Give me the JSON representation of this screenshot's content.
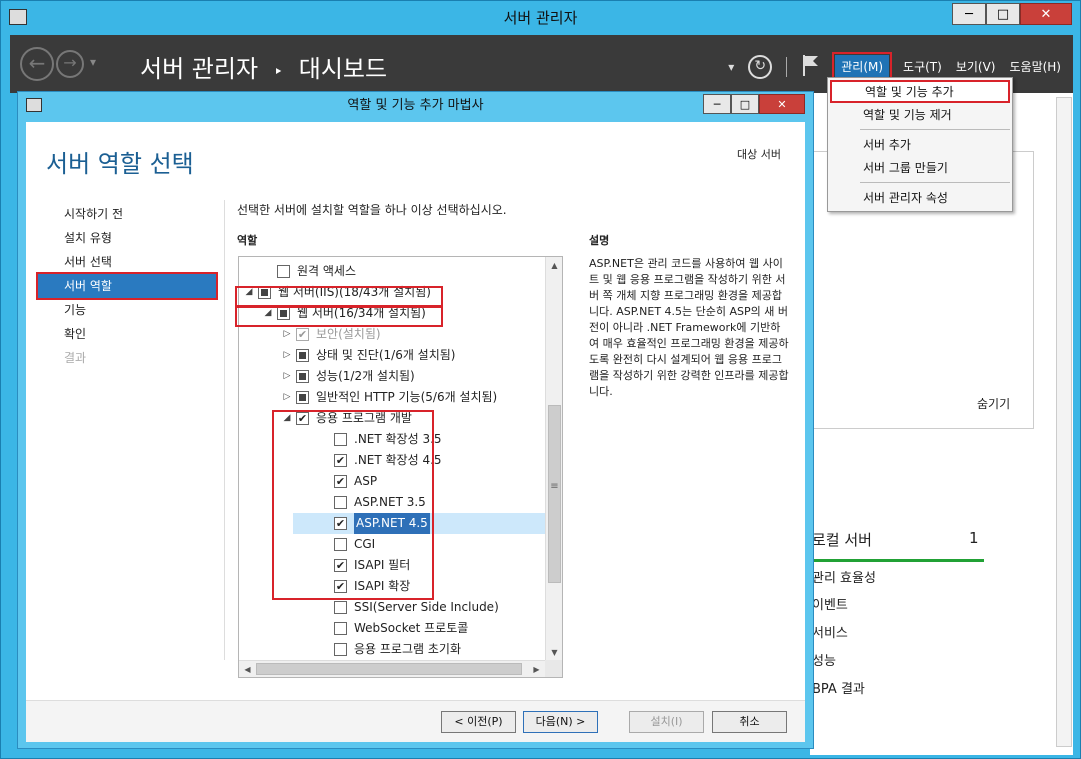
{
  "window": {
    "title": "서버 관리자",
    "minimize": "─",
    "maximize": "□",
    "close": "✕"
  },
  "appbar": {
    "back": "←",
    "forward": "→",
    "nav_dropdown": "▾",
    "title": "서버 관리자",
    "separator": "‣",
    "subtitle": "대시보드",
    "refresh_dropdown": "▾",
    "refresh": "↻",
    "menus": [
      "관리(M)",
      "도구(T)",
      "보기(V)",
      "도움말(H)"
    ]
  },
  "manage_menu": {
    "items": [
      "역할 및 기능 추가",
      "역할 및 기능 제거",
      "서버 추가",
      "서버 그룹 만들기",
      "서버 관리자 속성"
    ]
  },
  "background": {
    "hide": "숨기기",
    "local_server": "로컬 서버",
    "local_server_count": "1",
    "items": [
      "관리 효율성",
      "이벤트",
      "서비스",
      "성능",
      "BPA 결과"
    ]
  },
  "dialog": {
    "title": "역할 및 기능 추가 마법사",
    "minimize": "─",
    "maximize": "□",
    "close": "✕",
    "page_title": "서버 역할 선택",
    "destination": "대상 서버",
    "steps": [
      "시작하기 전",
      "설치 유형",
      "서버 선택",
      "서버 역할",
      "기능",
      "확인",
      "결과"
    ],
    "instruction": "선택한 서버에 설치할 역할을 하나 이상 선택하십시오.",
    "roles_label": "역할",
    "desc_label": "설명",
    "description": "ASP.NET은 관리 코드를 사용하여 웹 사이트 및 웹 응용 프로그램을 작성하기 위한 서버 쪽 개체 지향 프로그래밍 환경을 제공합니다. ASP.NET 4.5는 단순히 ASP의 새 버전이 아니라 .NET Framework에 기반하여 매우 효율적인 프로그래밍 환경을 제공하도록 완전히 다시 설계되어 웹 응용 프로그램을 작성하기 위한 강력한 인프라를 제공합니다.",
    "tree": [
      {
        "label": "원격 액세스",
        "state": "unchecked",
        "expander": ""
      },
      {
        "label": "웹 서버(IIS)(18/43개 설치됨)",
        "state": "partial",
        "expander": "◢"
      },
      {
        "label": "웹 서버(16/34개 설치됨)",
        "state": "partial",
        "expander": "◢"
      },
      {
        "label": "보안(설치됨)",
        "state": "checked-disabled",
        "expander": "▷"
      },
      {
        "label": "상태 및 진단(1/6개 설치됨)",
        "state": "partial",
        "expander": "▷"
      },
      {
        "label": "성능(1/2개 설치됨)",
        "state": "partial",
        "expander": "▷"
      },
      {
        "label": "일반적인 HTTP 기능(5/6개 설치됨)",
        "state": "partial",
        "expander": "▷"
      },
      {
        "label": "응용 프로그램 개발",
        "state": "checked",
        "expander": "◢"
      },
      {
        "label": ".NET 확장성 3.5",
        "state": "unchecked",
        "expander": ""
      },
      {
        "label": ".NET 확장성 4.5",
        "state": "checked",
        "expander": ""
      },
      {
        "label": "ASP",
        "state": "checked",
        "expander": ""
      },
      {
        "label": "ASP.NET 3.5",
        "state": "unchecked",
        "expander": ""
      },
      {
        "label": "ASP.NET 4.5",
        "state": "checked",
        "expander": ""
      },
      {
        "label": "CGI",
        "state": "unchecked",
        "expander": ""
      },
      {
        "label": "ISAPI 필터",
        "state": "checked",
        "expander": ""
      },
      {
        "label": "ISAPI 확장",
        "state": "checked",
        "expander": ""
      },
      {
        "label": "SSI(Server Side Include)",
        "state": "unchecked",
        "expander": ""
      },
      {
        "label": "WebSocket 프로토콜",
        "state": "unchecked",
        "expander": ""
      },
      {
        "label": "응용 프로그램 초기화",
        "state": "unchecked",
        "expander": ""
      }
    ],
    "scroll": {
      "up": "▲",
      "down": "▼",
      "left": "◀",
      "right": "▶",
      "grip": "≡"
    },
    "buttons": {
      "prev": "< 이전(P)",
      "next": "다음(N) >",
      "install": "설치(I)",
      "cancel": "취소"
    }
  }
}
